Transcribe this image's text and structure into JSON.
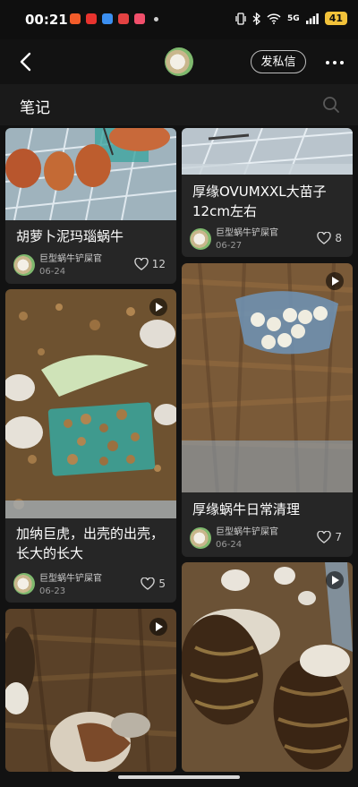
{
  "status_bar": {
    "time": "00:21",
    "signal": "5G",
    "battery": "41"
  },
  "topbar": {
    "dm_label": "发私信"
  },
  "section": {
    "title": "笔记"
  },
  "cards": [
    {
      "title": "胡萝卜泥玛瑙蜗牛",
      "author": "巨型蜗牛铲屎官",
      "date": "06-24",
      "likes": "12",
      "video": false
    },
    {
      "title": "厚缘OVUMXXL大苗子12cm左右",
      "author": "巨型蜗牛铲屎官",
      "date": "06-27",
      "likes": "8",
      "video": false
    },
    {
      "title": "加纳巨虎，出壳的出壳，长大的长大",
      "author": "巨型蜗牛铲屎官",
      "date": "06-23",
      "likes": "5",
      "video": true
    },
    {
      "title": "厚缘蜗牛日常清理",
      "author": "巨型蜗牛铲屎官",
      "date": "06-24",
      "likes": "7",
      "video": true
    },
    {
      "video": true
    },
    {
      "video": true
    }
  ],
  "colors": {
    "background": "#121212",
    "card": "#262626",
    "battery": "#f2c23a"
  }
}
